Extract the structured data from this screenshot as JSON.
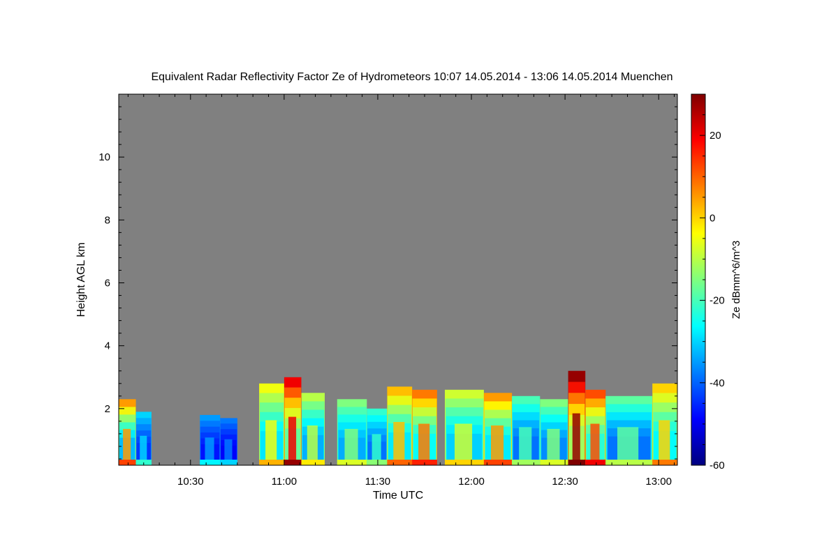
{
  "chart_data": {
    "type": "heatmap",
    "title": "Equivalent Radar Reflectivity Factor Ze of Hydrometeors   10:07 14.05.2014 - 13:06 14.05.2014 Muenchen",
    "xlabel": "Time UTC",
    "ylabel": "Height AGL km",
    "colorbar_label": "Ze dBmm^6/m^3",
    "x_range_minutes_utc": [
      607,
      786
    ],
    "y_range_km": [
      0.2,
      12.0
    ],
    "x_ticks": [
      {
        "minute": 630,
        "label": "10:30"
      },
      {
        "minute": 660,
        "label": "11:00"
      },
      {
        "minute": 690,
        "label": "11:30"
      },
      {
        "minute": 720,
        "label": "12:00"
      },
      {
        "minute": 750,
        "label": "12:30"
      },
      {
        "minute": 780,
        "label": "13:00"
      }
    ],
    "y_ticks": [
      {
        "value": 2,
        "label": "2"
      },
      {
        "value": 4,
        "label": "4"
      },
      {
        "value": 6,
        "label": "6"
      },
      {
        "value": 8,
        "label": "8"
      },
      {
        "value": 10,
        "label": "10"
      }
    ],
    "colorbar_range": [
      -60,
      30
    ],
    "colorbar_ticks": [
      {
        "value": 20,
        "label": "20"
      },
      {
        "value": 0,
        "label": "0"
      },
      {
        "value": -20,
        "label": "-20"
      },
      {
        "value": -40,
        "label": "-40"
      },
      {
        "value": -60,
        "label": "-60"
      }
    ],
    "background_color": "#808080",
    "colormap": [
      "#00007f",
      "#0000ff",
      "#007fff",
      "#00ffff",
      "#7fff7f",
      "#ffff00",
      "#ff7f00",
      "#ff0000",
      "#7f0000"
    ],
    "echo_cells": [
      {
        "start": 607.0,
        "end": 612.5,
        "top_km": 2.3,
        "peak_ze": 5,
        "base_ze": -35
      },
      {
        "start": 612.5,
        "end": 617.5,
        "top_km": 1.9,
        "peak_ze": -30,
        "base_ze": -45
      },
      {
        "start": 633.0,
        "end": 639.5,
        "top_km": 1.8,
        "peak_ze": -35,
        "base_ze": -48
      },
      {
        "start": 639.5,
        "end": 645.0,
        "top_km": 1.7,
        "peak_ze": -38,
        "base_ze": -50
      },
      {
        "start": 652.0,
        "end": 660.0,
        "top_km": 2.8,
        "peak_ze": -5,
        "base_ze": -30
      },
      {
        "start": 660.0,
        "end": 665.5,
        "top_km": 3.0,
        "peak_ze": 20,
        "base_ze": -20
      },
      {
        "start": 665.5,
        "end": 673.0,
        "top_km": 2.5,
        "peak_ze": -10,
        "base_ze": -35
      },
      {
        "start": 677.0,
        "end": 686.5,
        "top_km": 2.3,
        "peak_ze": -15,
        "base_ze": -35
      },
      {
        "start": 686.5,
        "end": 693.0,
        "top_km": 2.0,
        "peak_ze": -22,
        "base_ze": -40
      },
      {
        "start": 693.0,
        "end": 701.0,
        "top_km": 2.7,
        "peak_ze": 2,
        "base_ze": -30
      },
      {
        "start": 701.0,
        "end": 709.0,
        "top_km": 2.6,
        "peak_ze": 8,
        "base_ze": -28
      },
      {
        "start": 711.5,
        "end": 724.0,
        "top_km": 2.6,
        "peak_ze": -8,
        "base_ze": -32
      },
      {
        "start": 724.0,
        "end": 733.0,
        "top_km": 2.5,
        "peak_ze": 5,
        "base_ze": -30
      },
      {
        "start": 733.0,
        "end": 742.0,
        "top_km": 2.4,
        "peak_ze": -20,
        "base_ze": -40
      },
      {
        "start": 742.0,
        "end": 751.0,
        "top_km": 2.3,
        "peak_ze": -15,
        "base_ze": -38
      },
      {
        "start": 751.0,
        "end": 756.5,
        "top_km": 3.2,
        "peak_ze": 28,
        "base_ze": -15
      },
      {
        "start": 756.5,
        "end": 763.0,
        "top_km": 2.6,
        "peak_ze": 12,
        "base_ze": -25
      },
      {
        "start": 763.0,
        "end": 778.0,
        "top_km": 2.4,
        "peak_ze": -18,
        "base_ze": -40
      },
      {
        "start": 778.0,
        "end": 786.0,
        "top_km": 2.8,
        "peak_ze": 0,
        "base_ze": -28
      }
    ]
  }
}
